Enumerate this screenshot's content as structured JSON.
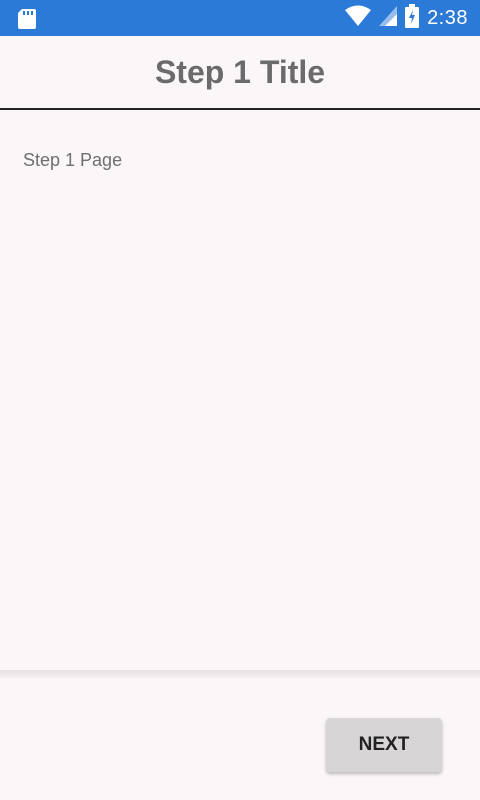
{
  "status_bar": {
    "time": "2:38",
    "left_icon": "sd-card-icon",
    "icons": [
      "wifi-icon",
      "cellular-signal-icon",
      "battery-icon"
    ],
    "background": "#2c7ad8"
  },
  "app_bar": {
    "title": "Step 1 Title"
  },
  "content": {
    "page_label": "Step 1 Page"
  },
  "footer": {
    "next_label": "NEXT"
  }
}
